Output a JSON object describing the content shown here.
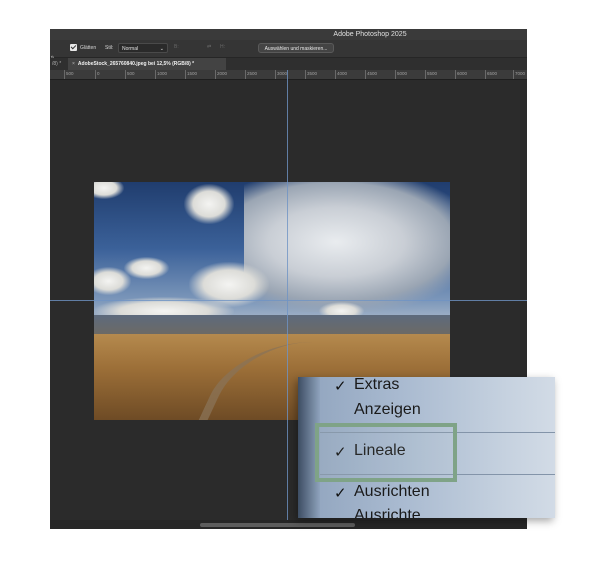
{
  "window": {
    "title": "Adobe Photoshop 2025"
  },
  "options_bar": {
    "left_edge": "↰",
    "smooth_label": "Glätten",
    "style_label": "Stil:",
    "style_value": "Normal",
    "width_label": "B:",
    "height_label": "H:",
    "select_mask_button": "Auswählen und maskieren..."
  },
  "tabs": [
    {
      "label": "/8) *"
    },
    {
      "close": "×",
      "label": "AdobeStock_265760840.jpeg bei 12,5% (RGB/8) *"
    }
  ],
  "ruler": {
    "ticks": [
      "500",
      "0",
      "500",
      "1000",
      "1500",
      "2000",
      "2500",
      "3000",
      "3500",
      "4000",
      "4500",
      "5000",
      "5500",
      "6000",
      "6500",
      "7000"
    ]
  },
  "context_menu": {
    "items": [
      {
        "label": "Extras",
        "checked": true
      },
      {
        "label": "Anzeigen",
        "checked": false
      },
      {
        "label": "Lineale",
        "checked": true,
        "highlighted": true
      },
      {
        "label": "Ausrichten",
        "checked": true
      },
      {
        "label": "Ausrichte",
        "checked": false,
        "clipped": true
      }
    ],
    "check_mark": "✓"
  },
  "colors": {
    "app_bg": "#2b2b2b",
    "guide": "#6f93c4",
    "highlight_frame": "#7fa387",
    "menu_bg": "#b3c2d4"
  }
}
